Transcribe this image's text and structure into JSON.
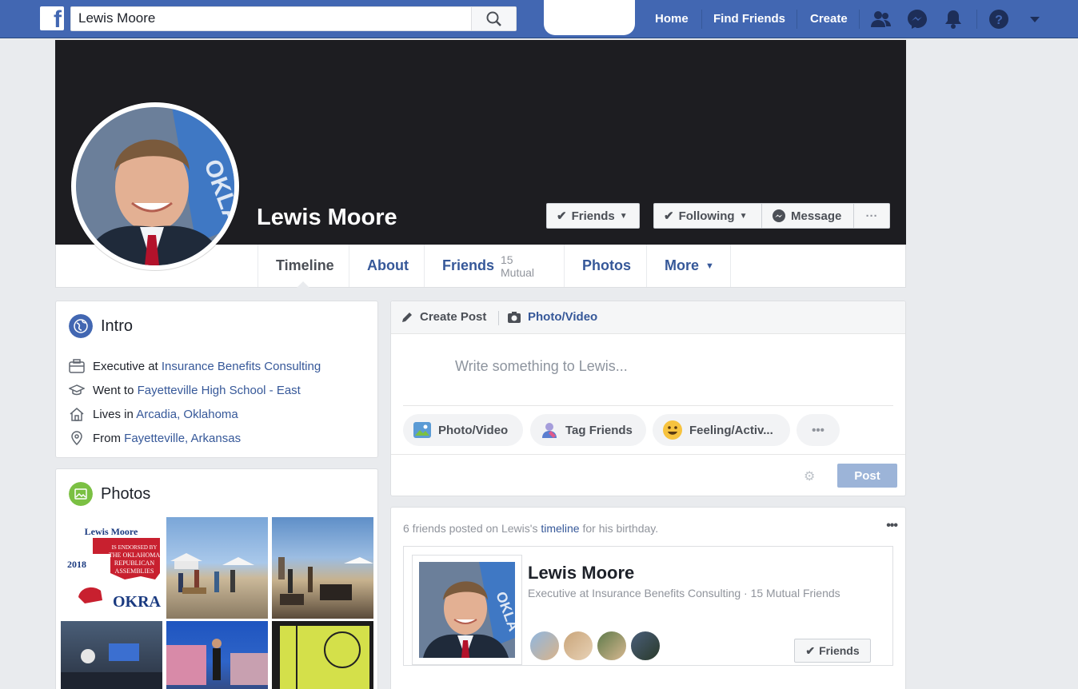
{
  "topbar": {
    "logo_letter": "f",
    "search_value": "Lewis Moore",
    "nav": {
      "home": "Home",
      "find_friends": "Find Friends",
      "create": "Create"
    }
  },
  "profile": {
    "name": "Lewis Moore",
    "buttons": {
      "friends": "Friends",
      "following": "Following",
      "message": "Message",
      "more": "···"
    }
  },
  "tabs": {
    "timeline": "Timeline",
    "about": "About",
    "friends": "Friends",
    "friends_mutual": "15 Mutual",
    "photos": "Photos",
    "more": "More"
  },
  "intro": {
    "title": "Intro",
    "items": [
      {
        "prefix": "Executive at",
        "link": "Insurance Benefits Consulting"
      },
      {
        "prefix": "Went to",
        "link": "Fayetteville High School - East"
      },
      {
        "prefix": "Lives in",
        "link": "Arcadia, Oklahoma"
      },
      {
        "prefix": "From",
        "link": "Fayetteville, Arkansas"
      }
    ]
  },
  "photos": {
    "title": "Photos",
    "poster": {
      "name": "Lewis Moore",
      "line1": "IS ENDORSED BY",
      "line2": "THE OKLAHOMA",
      "line3": "REPUBLICAN",
      "line4": "ASSEMBLIES",
      "year": "2018",
      "org": "OKRA"
    }
  },
  "composer": {
    "create_post": "Create Post",
    "photo_video_tab": "Photo/Video",
    "placeholder": "Write something to Lewis...",
    "actions": {
      "photo_video": "Photo/Video",
      "tag_friends": "Tag Friends",
      "feeling": "Feeling/Activ...",
      "more": "•••"
    },
    "post": "Post"
  },
  "birthday": {
    "prefix": "6 friends posted on Lewis's",
    "link": "timeline",
    "suffix": "for his birthday.",
    "more": "•••",
    "card_name": "Lewis Moore",
    "card_sub": "Executive at Insurance Benefits Consulting · 15 Mutual Friends",
    "friends_button": "Friends"
  },
  "colors": {
    "brand": "#4267b2",
    "link": "#365899",
    "background": "#e9ebee"
  }
}
